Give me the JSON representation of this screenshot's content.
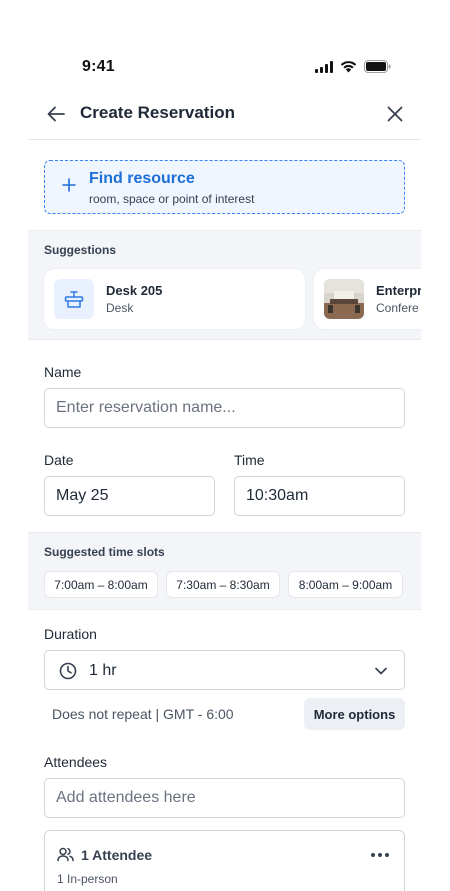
{
  "status_bar": {
    "time": "9:41"
  },
  "header": {
    "title": "Create Reservation"
  },
  "find_resource": {
    "title": "Find resource",
    "subtitle": "room, space or point of interest"
  },
  "suggestions": {
    "label": "Suggestions",
    "items": [
      {
        "title": "Desk 205",
        "subtitle": "Desk",
        "icon": "desk-icon"
      },
      {
        "title": "Enterpri",
        "subtitle": "Confere",
        "icon": "room-photo"
      }
    ]
  },
  "name_field": {
    "label": "Name",
    "placeholder": "Enter reservation name..."
  },
  "date_field": {
    "label": "Date",
    "value": "May 25"
  },
  "time_field": {
    "label": "Time",
    "value": "10:30am"
  },
  "time_slots": {
    "label": "Suggested time slots",
    "slots": [
      "7:00am – 8:00am",
      "7:30am – 8:30am",
      "8:00am – 9:00am"
    ]
  },
  "duration": {
    "label": "Duration",
    "value": "1 hr"
  },
  "repeat": {
    "text": "Does not repeat | GMT - 6:00",
    "more_options_label": "More options"
  },
  "attendees": {
    "label": "Attendees",
    "placeholder": "Add attendees here",
    "summary_title": "1 Attendee",
    "summary_sub": "1 In-person"
  },
  "colors": {
    "accent": "#1d6fd8",
    "accent_border": "#3b82f6",
    "accent_bg": "#eff6ff",
    "section_bg": "#f3f5f9"
  }
}
